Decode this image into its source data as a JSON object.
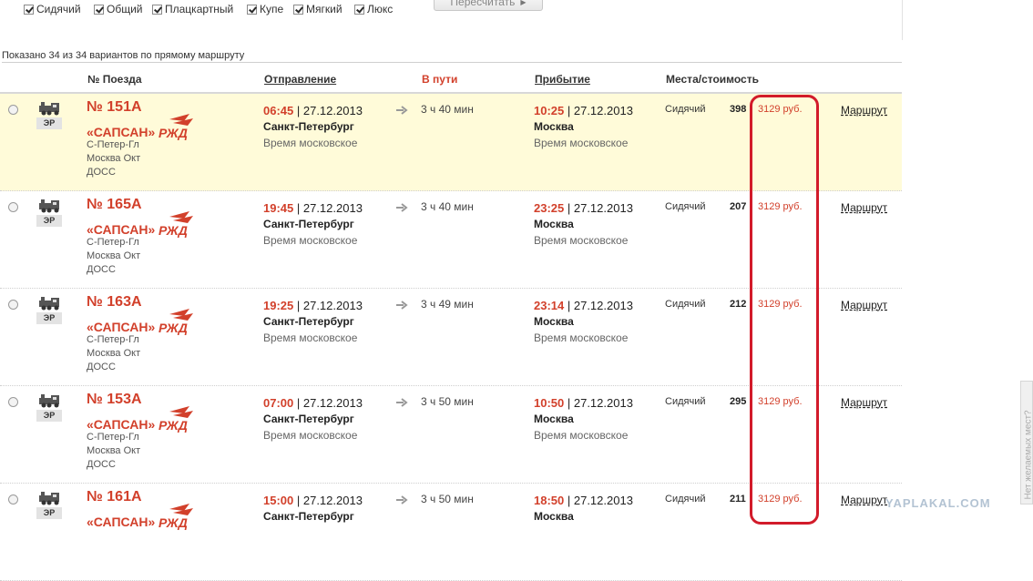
{
  "filters": [
    {
      "label": "Сидячий",
      "checked": true
    },
    {
      "label": "Общий",
      "checked": true
    },
    {
      "label": "Плацкартный",
      "checked": true
    },
    {
      "label": "Купе",
      "checked": true
    },
    {
      "label": "Мягкий",
      "checked": true
    },
    {
      "label": "Люкс",
      "checked": true
    }
  ],
  "recalc_label": "Пересчитать",
  "summary": "Показано 34 из 34 вариантов по прямому маршруту",
  "headers": {
    "train": "№ Поезда",
    "departure": "Отправление",
    "duration": "В пути",
    "arrival": "Прибытие",
    "seats": "Места/стоимость"
  },
  "rows": [
    {
      "number": "№ 151А",
      "name": "«САПСАН»",
      "class": "ЭР",
      "route": [
        "С-Петер-Гл",
        "Москва Окт",
        "ДОСС"
      ],
      "dep_time": "06:45",
      "dep_date": "| 27.12.2013",
      "dep_city": "Санкт-Петербург",
      "dep_tz": "Время московское",
      "duration": "3 ч 40 мин",
      "arr_time": "10:25",
      "arr_date": "| 27.12.2013",
      "arr_city": "Москва",
      "arr_tz": "Время московское",
      "seat_type": "Сидячий",
      "seat_count": "398",
      "price": "3129 руб.",
      "route_link": "Маршрут",
      "highlighted": true
    },
    {
      "number": "№ 165А",
      "name": "«САПСАН»",
      "class": "ЭР",
      "route": [
        "С-Петер-Гл",
        "Москва Окт",
        "ДОСС"
      ],
      "dep_time": "19:45",
      "dep_date": "| 27.12.2013",
      "dep_city": "Санкт-Петербург",
      "dep_tz": "Время московское",
      "duration": "3 ч 40 мин",
      "arr_time": "23:25",
      "arr_date": "| 27.12.2013",
      "arr_city": "Москва",
      "arr_tz": "Время московское",
      "seat_type": "Сидячий",
      "seat_count": "207",
      "price": "3129 руб.",
      "route_link": "Маршрут",
      "highlighted": false
    },
    {
      "number": "№ 163А",
      "name": "«САПСАН»",
      "class": "ЭР",
      "route": [
        "С-Петер-Гл",
        "Москва Окт",
        "ДОСС"
      ],
      "dep_time": "19:25",
      "dep_date": "| 27.12.2013",
      "dep_city": "Санкт-Петербург",
      "dep_tz": "Время московское",
      "duration": "3 ч 49 мин",
      "arr_time": "23:14",
      "arr_date": "| 27.12.2013",
      "arr_city": "Москва",
      "arr_tz": "Время московское",
      "seat_type": "Сидячий",
      "seat_count": "212",
      "price": "3129 руб.",
      "route_link": "Маршрут",
      "highlighted": false
    },
    {
      "number": "№ 153А",
      "name": "«САПСАН»",
      "class": "ЭР",
      "route": [
        "С-Петер-Гл",
        "Москва Окт",
        "ДОСС"
      ],
      "dep_time": "07:00",
      "dep_date": "| 27.12.2013",
      "dep_city": "Санкт-Петербург",
      "dep_tz": "Время московское",
      "duration": "3 ч 50 мин",
      "arr_time": "10:50",
      "arr_date": "| 27.12.2013",
      "arr_city": "Москва",
      "arr_tz": "Время московское",
      "seat_type": "Сидячий",
      "seat_count": "295",
      "price": "3129 руб.",
      "route_link": "Маршрут",
      "highlighted": false
    },
    {
      "number": "№ 161А",
      "name": "«САПСАН»",
      "class": "ЭР",
      "route": [],
      "dep_time": "15:00",
      "dep_date": "| 27.12.2013",
      "dep_city": "Санкт-Петербург",
      "dep_tz": "",
      "duration": "3 ч 50 мин",
      "arr_time": "18:50",
      "arr_date": "| 27.12.2013",
      "arr_city": "Москва",
      "arr_tz": "",
      "seat_type": "Сидячий",
      "seat_count": "211",
      "price": "3129 руб.",
      "route_link": "Маршрут",
      "highlighted": false
    }
  ],
  "side_tab": "Нет желаемых мест?",
  "watermark": "YAPLAKAL.COM",
  "colors": {
    "accent": "#d2402b",
    "highlight_row": "#fffbd9",
    "annotation": "#d21b2a"
  },
  "icons": {
    "train": "locomotive-icon",
    "logo": "rzd-logo",
    "next": "arrow-right-icon"
  }
}
